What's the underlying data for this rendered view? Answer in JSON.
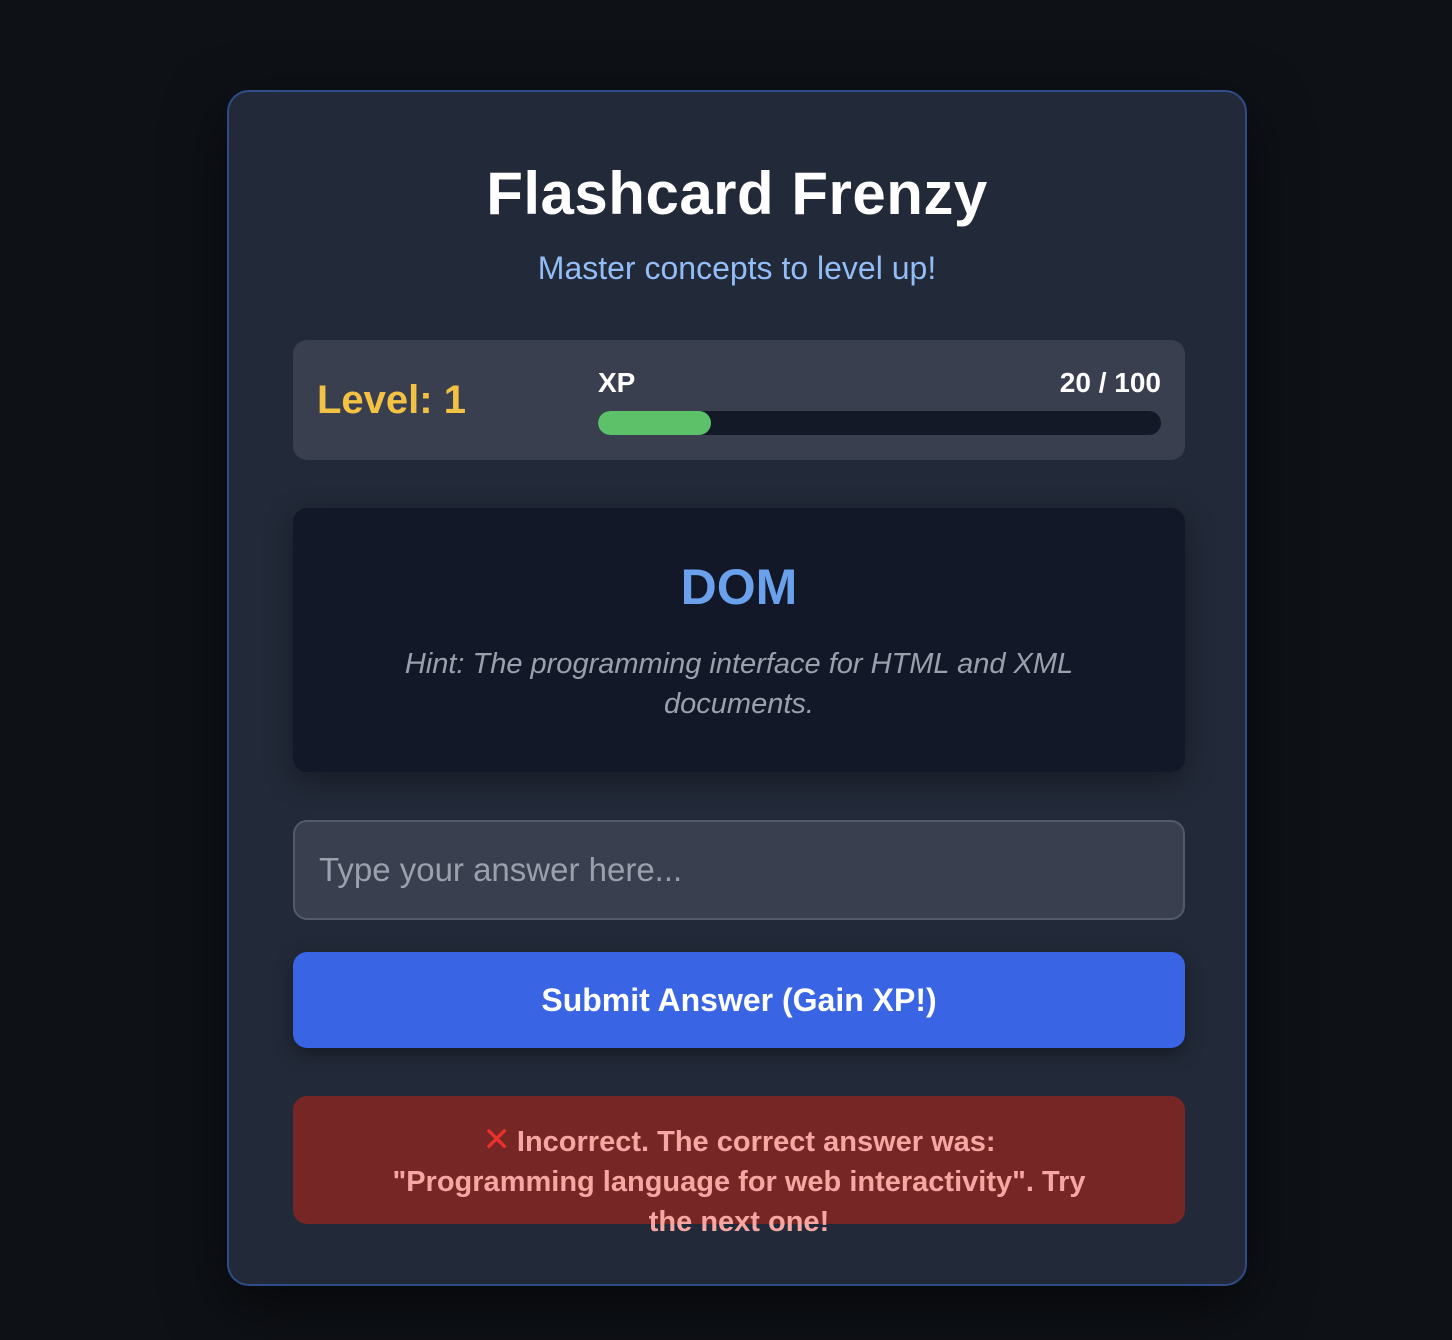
{
  "app": {
    "title": "Flashcard Frenzy",
    "subtitle": "Master concepts to level up!"
  },
  "stats": {
    "level_text": "Level: 1",
    "xp_label": "XP",
    "xp_text": "20 / 100",
    "xp_progress_percent": 20
  },
  "flashcard": {
    "term": "DOM",
    "hint": "Hint: The programming interface for HTML and XML documents."
  },
  "answer": {
    "value": "",
    "placeholder": "Type your answer here..."
  },
  "submit_label": "Submit Answer (Gain XP!)",
  "feedback": {
    "icon": "cross-mark-icon",
    "glyph": "✕",
    "message": "Incorrect. The correct answer was: \"Programming language for web interactivity\". Try the next one!"
  },
  "colors": {
    "page_background": "#0e1116",
    "card_background": "#222938",
    "card_border": "#2f4c86",
    "level": "#f4c243",
    "xp_fill": "#5dc169",
    "term": "#6aa0ec",
    "subtitle": "#93bdf6",
    "submit_button": "#3964e3",
    "error_background": "#762625",
    "error_text": "#f7a7a3",
    "error_icon": "#e8322c"
  }
}
